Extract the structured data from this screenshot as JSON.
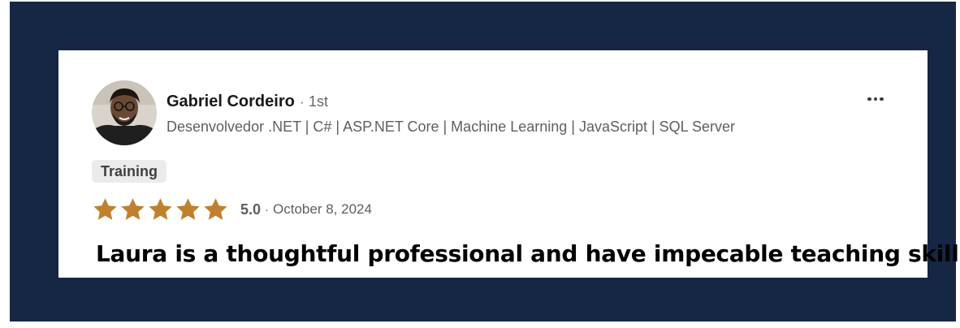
{
  "reviewer": {
    "name": "Gabriel Cordeiro",
    "separator": "·",
    "degree": "1st",
    "headline": "Desenvolvedor .NET | C# | ASP.NET Core | Machine Learning | JavaScript | SQL Server",
    "avatar_icon": "user-photo-avatar"
  },
  "menu": {
    "icon": "more-horizontal-icon"
  },
  "tag": {
    "label": "Training"
  },
  "rating": {
    "value": 5,
    "max": 5,
    "score_text": "5.0",
    "separator": "·",
    "date": "October 8, 2024",
    "star_color": "#c0812f"
  },
  "review": {
    "text": "Laura is a thoughtful professional and have impecable teaching skills"
  },
  "colors": {
    "frame": "#152743",
    "card": "#ffffff"
  }
}
